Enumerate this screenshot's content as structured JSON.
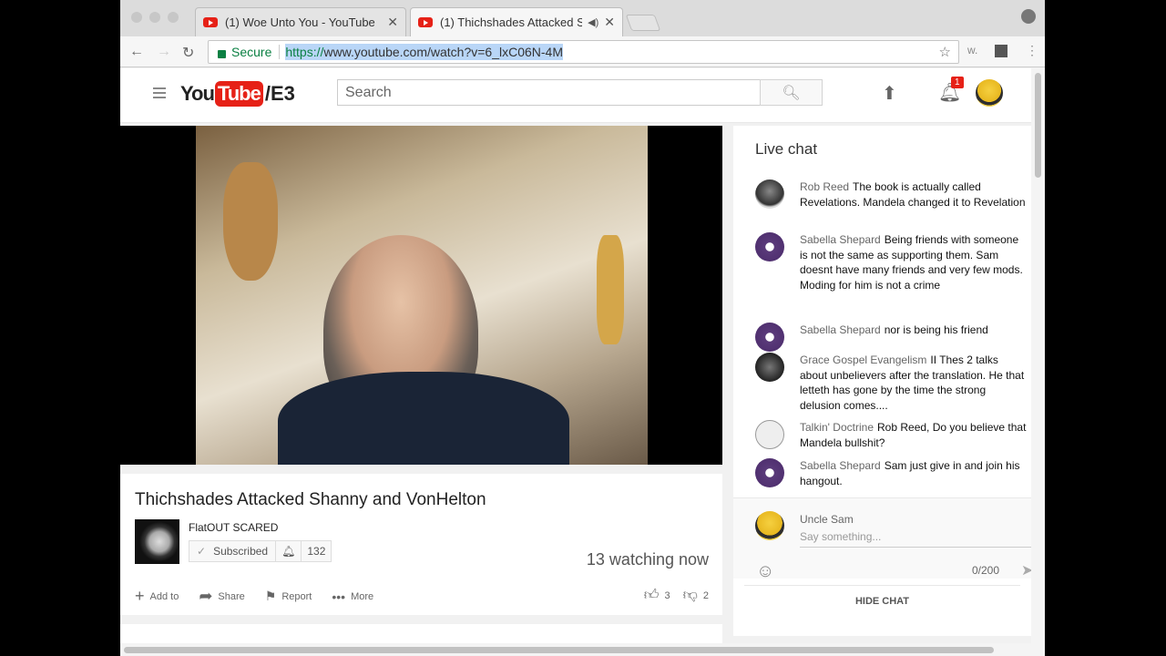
{
  "browser": {
    "tabs": [
      {
        "title": "(1) Woe Unto You - YouTube"
      },
      {
        "title": "(1) Thichshades Attacked S"
      }
    ],
    "secure_label": "Secure",
    "url_scheme": "https://",
    "url_rest": "www.youtube.com/watch?v=6_lxC06N-4M"
  },
  "youtube": {
    "logo_you": "You",
    "logo_tube": "Tube",
    "logo_suffix": "/E3",
    "search_placeholder": "Search",
    "notification_count": "1"
  },
  "video": {
    "title": "Thichshades Attacked Shanny and VonHelton",
    "channel": "FlatOUT SCARED",
    "subscribe_label": "Subscribed",
    "subscriber_count": "132",
    "watching": "13 watching now",
    "actions": {
      "add_to": "Add to",
      "share": "Share",
      "report": "Report",
      "more": "More"
    },
    "likes": "3",
    "dislikes": "2"
  },
  "chat": {
    "header": "Live chat",
    "messages": [
      {
        "author": "Rob Reed",
        "text": "The book is actually called Revelations. Mandela changed it to Revelation"
      },
      {
        "author": "Sabella Shepard",
        "text": "Being friends with someone is not the same as supporting them. Sam doesnt have many friends and very few mods. Moding for him is not a crime"
      },
      {
        "author": "Sabella Shepard",
        "text": "nor is being his friend"
      },
      {
        "author": "Grace Gospel Evangelism",
        "text": "II Thes 2 talks about unbelievers after the translation. He that letteth has gone by the time the strong delusion comes...."
      },
      {
        "author": "Talkin' Doctrine",
        "text": "Rob Reed, Do you believe that Mandela bullshit?"
      },
      {
        "author": "Sabella Shepard",
        "text": "Sam just give in and join his hangout."
      }
    ],
    "current_user": "Uncle Sam",
    "input_placeholder": "Say something...",
    "char_count": "0/200",
    "hide_label": "HIDE CHAT"
  }
}
